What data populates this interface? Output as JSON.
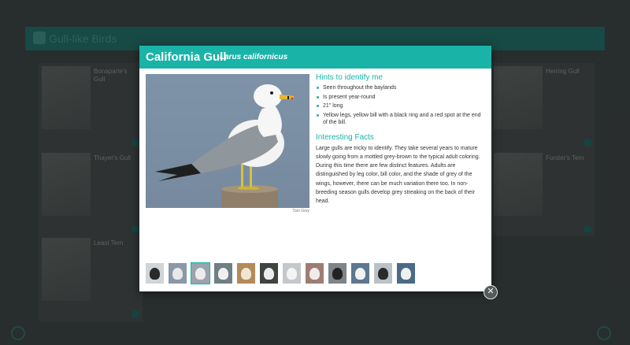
{
  "background": {
    "banner_title": "Gull-like Birds",
    "cards": [
      {
        "name": "Bonaparte's Gull"
      },
      {
        "name": "Herring Gull"
      },
      {
        "name": "Thayer's Gull"
      },
      {
        "name": "Forster's Tern"
      },
      {
        "name": "Least Tern"
      }
    ]
  },
  "modal": {
    "title": "California Gull",
    "scientific_name": "Larus californicus",
    "photo_credit": "Tom Grey",
    "hints_heading": "Hints to identify me",
    "hints": [
      "Seen throughout the baylands",
      "Is present year-round",
      "21\" long",
      "Yellow legs, yellow bill with a black ring and a red spot at the end of the bill."
    ],
    "facts_heading": "Interesting Facts",
    "facts_text": "Large gulls are tricky to identify. They take several years to mature slowly going from a mottled grey-brown to the typical adult coloring. During this time there are few distinct features. Adults are distinguished by leg color, bill color, and the shade of grey of the wings, however, there can be much variation there too. In non-breeding season gulls develop grey streaking on the back of their head.",
    "thumbnails": [
      {
        "bg": "#cfd5d8",
        "bird": "#2a2a2a",
        "active": false
      },
      {
        "bg": "#8a98a8",
        "bird": "#e8e8e8",
        "active": false
      },
      {
        "bg": "#9aa4ad",
        "bird": "#ececec",
        "active": true
      },
      {
        "bg": "#6f7f86",
        "bird": "#f0f0f0",
        "active": false
      },
      {
        "bg": "#b58a5a",
        "bird": "#efe6d6",
        "active": false
      },
      {
        "bg": "#3f4440",
        "bird": "#ececec",
        "active": false
      },
      {
        "bg": "#c4c8cc",
        "bird": "#f4f4f4",
        "active": false
      },
      {
        "bg": "#9f7d74",
        "bird": "#f0ece8",
        "active": false
      },
      {
        "bg": "#7d858a",
        "bird": "#222222",
        "active": false
      },
      {
        "bg": "#5d7890",
        "bird": "#f2f2f2",
        "active": false
      },
      {
        "bg": "#b9c2c8",
        "bird": "#2b2b2b",
        "active": false
      },
      {
        "bg": "#4b6a86",
        "bird": "#f0f0f0",
        "active": false
      }
    ],
    "close_symbol": "✕"
  },
  "colors": {
    "accent": "#1ab3a8",
    "header_text": "#ffffff"
  }
}
